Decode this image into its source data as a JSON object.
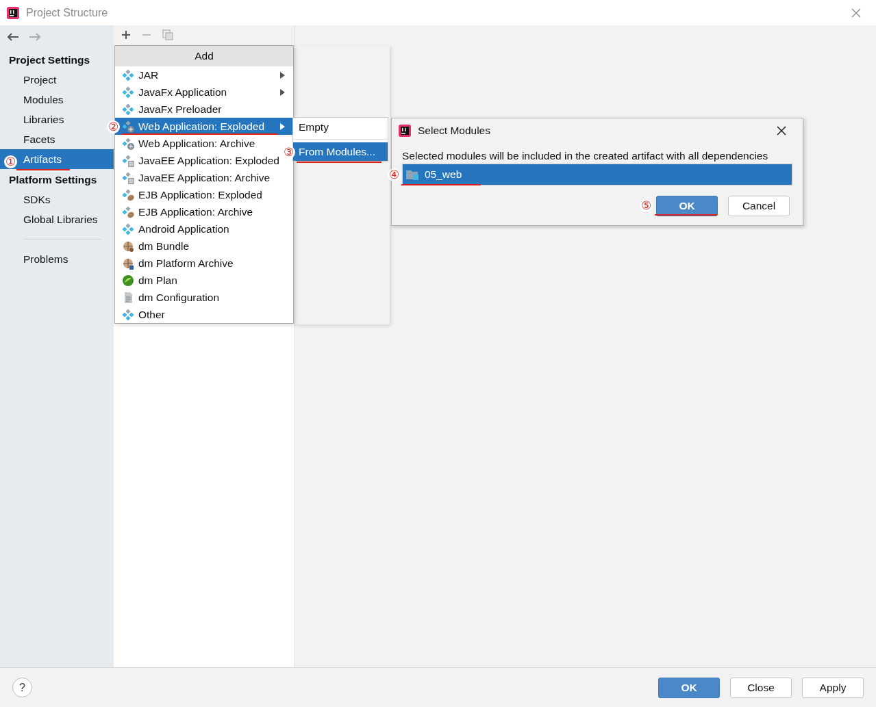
{
  "window": {
    "title": "Project Structure"
  },
  "sidebar": {
    "sections": [
      {
        "heading": "Project Settings",
        "items": [
          {
            "label": "Project",
            "selected": false
          },
          {
            "label": "Modules",
            "selected": false
          },
          {
            "label": "Libraries",
            "selected": false
          },
          {
            "label": "Facets",
            "selected": false
          },
          {
            "label": "Artifacts",
            "selected": true,
            "marker": "①"
          }
        ]
      },
      {
        "heading": "Platform Settings",
        "items": [
          {
            "label": "SDKs",
            "selected": false
          },
          {
            "label": "Global Libraries",
            "selected": false
          }
        ]
      }
    ],
    "extra_items": [
      {
        "label": "Problems",
        "selected": false
      }
    ]
  },
  "add_menu": {
    "title": "Add",
    "items": [
      {
        "label": "JAR",
        "kind": "artifact",
        "submenu": true,
        "selected": false
      },
      {
        "label": "JavaFx Application",
        "kind": "artifact",
        "submenu": true,
        "selected": false
      },
      {
        "label": "JavaFx Preloader",
        "kind": "artifact",
        "submenu": false,
        "selected": false
      },
      {
        "label": "Web Application: Exploded",
        "kind": "web",
        "submenu": true,
        "selected": true,
        "marker": "②"
      },
      {
        "label": "Web Application: Archive",
        "kind": "web",
        "submenu": false,
        "selected": false
      },
      {
        "label": "JavaEE Application: Exploded",
        "kind": "javaee",
        "submenu": false,
        "selected": false
      },
      {
        "label": "JavaEE Application: Archive",
        "kind": "javaee",
        "submenu": false,
        "selected": false
      },
      {
        "label": "EJB Application: Exploded",
        "kind": "ejb",
        "submenu": false,
        "selected": false
      },
      {
        "label": "EJB Application: Archive",
        "kind": "ejb",
        "submenu": false,
        "selected": false
      },
      {
        "label": "Android Application",
        "kind": "artifact",
        "submenu": false,
        "selected": false
      },
      {
        "label": "dm Bundle",
        "kind": "bundle",
        "submenu": false,
        "selected": false
      },
      {
        "label": "dm Platform Archive",
        "kind": "platform",
        "submenu": false,
        "selected": false
      },
      {
        "label": "dm Plan",
        "kind": "plan",
        "submenu": false,
        "selected": false
      },
      {
        "label": "dm Configuration",
        "kind": "config",
        "submenu": false,
        "selected": false
      },
      {
        "label": "Other",
        "kind": "artifact",
        "submenu": false,
        "selected": false
      }
    ]
  },
  "submenu": {
    "items": [
      {
        "label": "Empty",
        "selected": false
      },
      {
        "label": "From Modules...",
        "selected": true,
        "marker": "③"
      }
    ]
  },
  "dialog": {
    "title": "Select Modules",
    "message": "Selected modules will be included in the created artifact with all dependencies",
    "modules": [
      {
        "name": "05_web",
        "selected": true,
        "marker": "④"
      }
    ],
    "buttons": [
      {
        "label": "OK",
        "kind": "primary",
        "marker": "⑤"
      },
      {
        "label": "Cancel",
        "kind": "secondary"
      }
    ]
  },
  "footer": {
    "help": "?",
    "buttons": [
      {
        "label": "OK",
        "kind": "primary"
      },
      {
        "label": "Close",
        "kind": "secondary"
      },
      {
        "label": "Apply",
        "kind": "secondary"
      }
    ]
  }
}
